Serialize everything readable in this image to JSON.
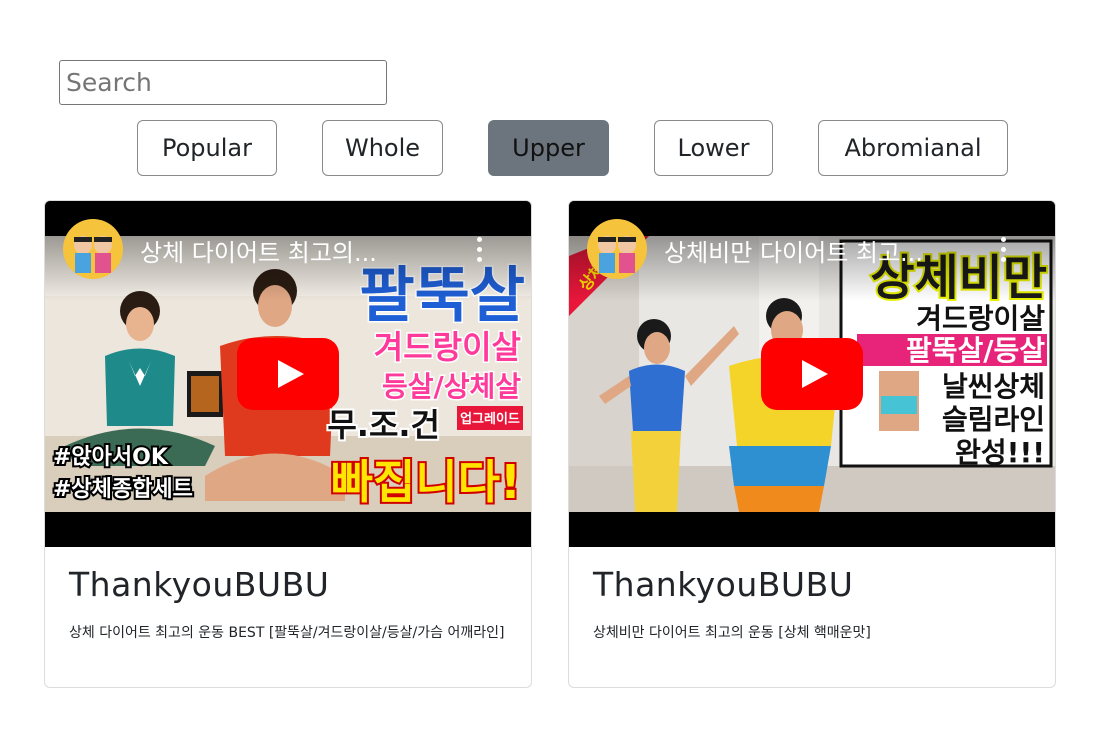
{
  "search": {
    "placeholder": "Search",
    "value": ""
  },
  "categories": [
    {
      "label": "Popular",
      "active": false
    },
    {
      "label": "Whole",
      "active": false
    },
    {
      "label": "Upper",
      "active": true
    },
    {
      "label": "Lower",
      "active": false
    },
    {
      "label": "Abromianal",
      "active": false
    }
  ],
  "videos": [
    {
      "video_title": "상체 다이어트 최고의...",
      "channel": "ThankyouBUBU",
      "description": "상체 다이어트 최고의 운동 BEST [팔뚝살/겨드랑이살/등살/가슴 어깨라인]",
      "thumb_text": {
        "big": "팔뚝살",
        "line1": "겨드랑이살",
        "line2": "등살/상체살",
        "line3": "무.조.건",
        "badge": "업그레이드",
        "line4": "빠집니다!",
        "tag1": "#앉아서OK",
        "tag2": "#상체종합세트"
      }
    },
    {
      "video_title": "상체비만 다이어트 최고...",
      "channel": "ThankyouBUBU",
      "description": "상체비만 다이어트 최고의 운동 [상체 핵매운맛]",
      "thumb_text": {
        "big": "상체비만",
        "line1": "겨드랑이살",
        "line2": "팔뚝살/등살",
        "line3": "날씬상체",
        "line4": "슬림라인",
        "line5": "완성!!!",
        "ribbon": "상체 핵"
      }
    }
  ],
  "colors": {
    "active_button": "#6c757d",
    "youtube_red": "#ff0000"
  },
  "icons": {
    "play": "youtube-play-icon",
    "menu": "kebab-menu-icon"
  }
}
